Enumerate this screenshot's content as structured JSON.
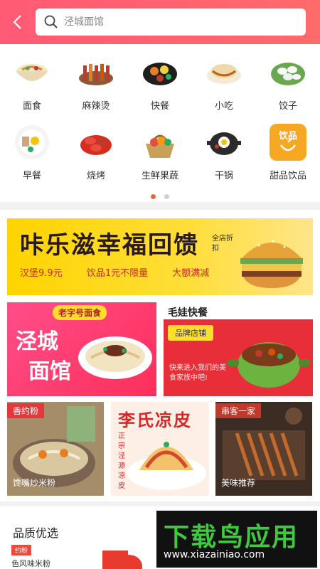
{
  "header": {
    "search_placeholder": "泾城面馆"
  },
  "categories": [
    {
      "label": "面食",
      "icon": "noodle-bowl-icon"
    },
    {
      "label": "麻辣烫",
      "icon": "skewers-icon"
    },
    {
      "label": "快餐",
      "icon": "bento-icon"
    },
    {
      "label": "小吃",
      "icon": "pancake-icon"
    },
    {
      "label": "饺子",
      "icon": "dumplings-icon"
    },
    {
      "label": "早餐",
      "icon": "breakfast-plate-icon"
    },
    {
      "label": "烧烤",
      "icon": "crayfish-icon"
    },
    {
      "label": "生鲜果蔬",
      "icon": "fruit-basket-icon"
    },
    {
      "label": "干锅",
      "icon": "dry-pot-icon"
    },
    {
      "label": "甜品饮品",
      "icon": "drink-cup-icon",
      "icon_text": "饮品"
    }
  ],
  "carousel": {
    "pages": 2,
    "active": 0
  },
  "banner": {
    "title": "咔乐滋幸福回馈",
    "badge": "全店折扣",
    "subs": [
      "汉堡9.9元",
      "饮品1元不限量",
      "大额满减"
    ]
  },
  "card_noodle": {
    "tag": "老字号面食",
    "line1": "泾城",
    "line2": "面馆"
  },
  "card_pot": {
    "title": "毛娃快餐",
    "pill": "品牌店铺",
    "note": "快来进入我们的美食家族中吧!"
  },
  "card_rice": {
    "tag": "香约粉",
    "caption": "馋嘴炒米粉"
  },
  "card_liangpi": {
    "title": "李氏凉皮",
    "vertical": "正宗泾源凉皮"
  },
  "card_bbq": {
    "tag": "串客一家",
    "caption": "美味推荐"
  },
  "quality": {
    "title": "品质优选",
    "mini_tag": "约粉",
    "item_name": "色风味米粉"
  },
  "watermark": {
    "brand": "下载鸟应用",
    "url": "www.xiazainiao.com"
  },
  "colors": {
    "header": "#ff5a76",
    "accent": "#e8683e",
    "red": "#e82e38",
    "yellow": "#ffd400"
  }
}
